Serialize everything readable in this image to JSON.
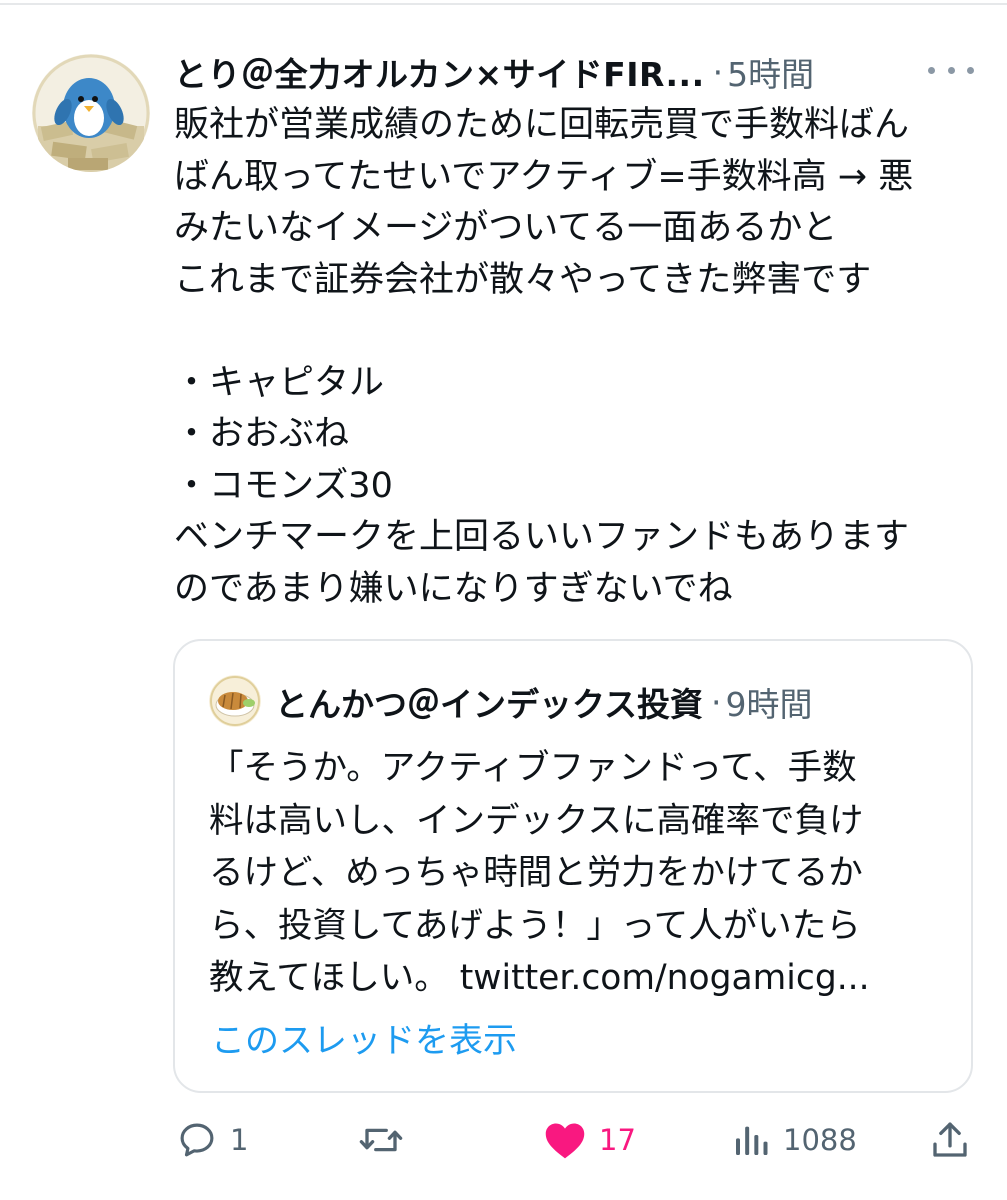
{
  "tweet": {
    "author_name": "とり＠全力オルカン×サイドFIR...",
    "separator": "·",
    "time": "5時間",
    "more_icon": "more-horizontal-icon",
    "text_lines": [
      "販社が営業成績のために回転売買で手数料ばん",
      "ばん取ってたせいでアクティブ=手数料高 → 悪",
      "みたいなイメージがついてる一面あるかと",
      "これまで証券会社が散々やってきた弊害です",
      "",
      "・キャピタル",
      "・おおぶね",
      "・コモンズ30",
      "ベンチマークを上回るいいファンドもあります",
      "のであまり嫌いになりすぎないでね"
    ]
  },
  "quote": {
    "author_name": "とんかつ＠インデックス投資",
    "separator": "·",
    "time": "9時間",
    "text_lines": [
      "「そうか。アクティブファンドって、手数",
      "料は高いし、インデックスに高確率で負け",
      "るけど、めっちゃ時間と労力をかけてるか",
      "ら、投資してあげよう！」って人がいたら",
      "教えてほしい。 twitter.com/nogamicg..."
    ],
    "show_thread": "このスレッドを表示"
  },
  "actions": {
    "reply": {
      "icon": "reply-icon",
      "count": "1"
    },
    "retweet": {
      "icon": "retweet-icon",
      "count": ""
    },
    "like": {
      "icon": "heart-icon",
      "count": "17",
      "liked": true
    },
    "views": {
      "icon": "views-icon",
      "count": "1088"
    },
    "share": {
      "icon": "share-icon"
    }
  },
  "colors": {
    "text_primary": "#0f1419",
    "text_secondary": "#536471",
    "link": "#1d9bf0",
    "like": "#f91880",
    "border": "#e3e6e9"
  }
}
